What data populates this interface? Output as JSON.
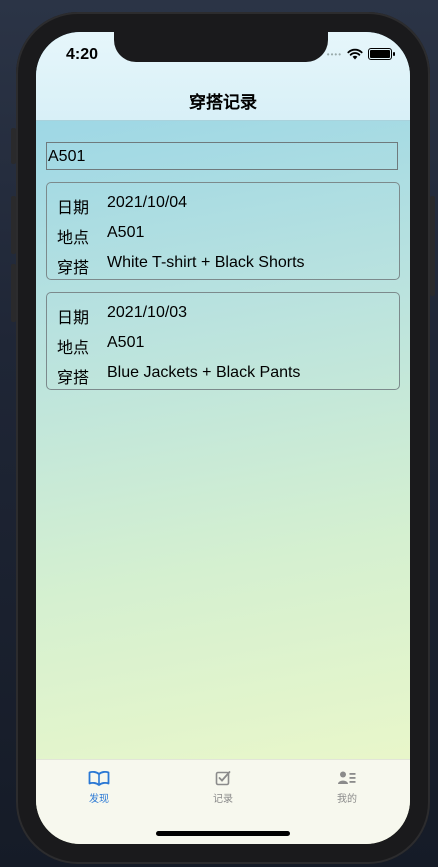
{
  "status_bar": {
    "time": "4:20"
  },
  "nav": {
    "title": "穿搭记录"
  },
  "search": {
    "value": "A501"
  },
  "records": [
    {
      "date_label": "日期",
      "date": "2021/10/04",
      "place_label": "地点",
      "place": "A501",
      "outfit_label": "穿搭",
      "outfit": "White T-shirt + Black Shorts"
    },
    {
      "date_label": "日期",
      "date": "2021/10/03",
      "place_label": "地点",
      "place": "A501",
      "outfit_label": "穿搭",
      "outfit": "Blue Jackets + Black Pants"
    }
  ],
  "tabs": [
    {
      "label": "发现",
      "icon": "book-icon",
      "active": true
    },
    {
      "label": "记录",
      "icon": "checkbox-icon",
      "active": false
    },
    {
      "label": "我的",
      "icon": "profile-icon",
      "active": false
    }
  ],
  "colors": {
    "accent": "#2a78d4",
    "inactive": "#8b8b8b"
  }
}
